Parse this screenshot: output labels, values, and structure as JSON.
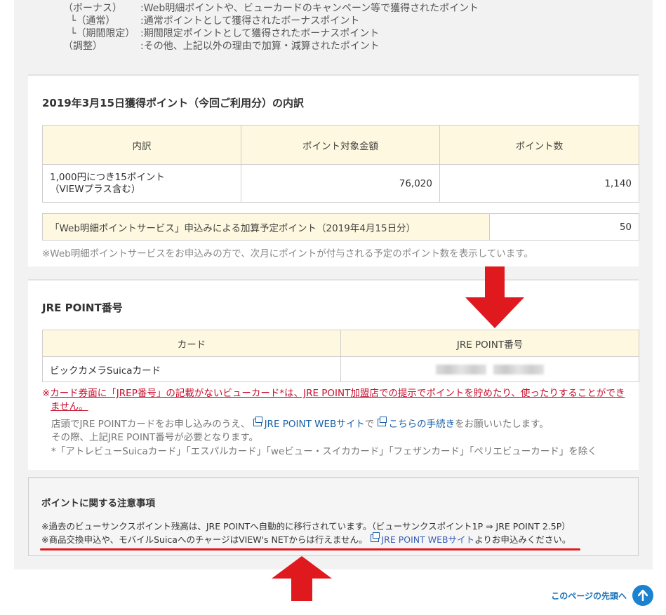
{
  "legend": [
    {
      "key": "（ボーナス）",
      "value": ":Web明細ポイントや、ビューカードのキャンペーン等で獲得されたポイント"
    },
    {
      "key": "└（通常）",
      "value": ":通常ポイントとして獲得されたボーナスポイント"
    },
    {
      "key": "└（期間限定）",
      "value": ":期間限定ポイントとして獲得されたボーナスポイント"
    },
    {
      "key": "（調整）",
      "value": ":その他、上記以外の理由で加算・減算されたポイント"
    }
  ],
  "breakdown": {
    "title": "2019年3月15日獲得ポイント（今回ご利用分）の内訳",
    "headers": [
      "内訳",
      "ポイント対象金額",
      "ポイント数"
    ],
    "row": {
      "label_line1": "1,000円につき15ポイント",
      "label_line2": "（VIEWプラス含む）",
      "amount": "76,020",
      "points": "1,140"
    },
    "web_row": {
      "label": "「Web明細ポイントサービス」申込みによる加算予定ポイント（2019年4月15日分）",
      "value": "50"
    },
    "note": "※Web明細ポイントサービスをお申込みの方で、次月にポイントが付与される予定のポイント数を表示しています。"
  },
  "jre": {
    "title": "JRE POINT番号",
    "headers": [
      "カード",
      "JRE POINT番号"
    ],
    "row": {
      "card": "ビックカメラSuicaカード"
    },
    "red_mark": "※",
    "red_line1": "カード券面に「JREP番号」の記載がないビューカード*は、JRE POINT加盟店での提示でポイントを貯めたり、使ったりすることができ",
    "red_line2": "ません。",
    "line3_pre": "店頭でJRE POINTカードをお申し込みのうえ、",
    "line3_link1": "JRE POINT WEBサイト",
    "line3_mid": "で",
    "line3_link2": "こちらの手続き",
    "line3_post": "をお願いいたします。",
    "line4": "その際、上記JRE POINT番号が必要となります。",
    "line5": "*「アトレビューSuicaカード」「エスパルカード」「weビュー・スイカカード」「フェザンカード」「ペリエビューカード」を除く"
  },
  "notice": {
    "title": "ポイントに関する注意事項",
    "line1": "※過去のビューサンクスポイント残高は、JRE POINTへ自動的に移行されています。（ビューサンクスポイント1P ⇒ JRE POINT 2.5P）",
    "line2_pre": "※商品交換申込や、モバイルSuicaへのチャージはVIEW's NETからは行えません。",
    "line2_link": "JRE POINT WEBサイト",
    "line2_post": "よりお申込みください。"
  },
  "pagetop": {
    "label": "このページの先頭へ"
  },
  "colors": {
    "accent_red": "#e0191e",
    "header_bg": "#fdf8df",
    "link_blue": "#1a5fa8"
  }
}
